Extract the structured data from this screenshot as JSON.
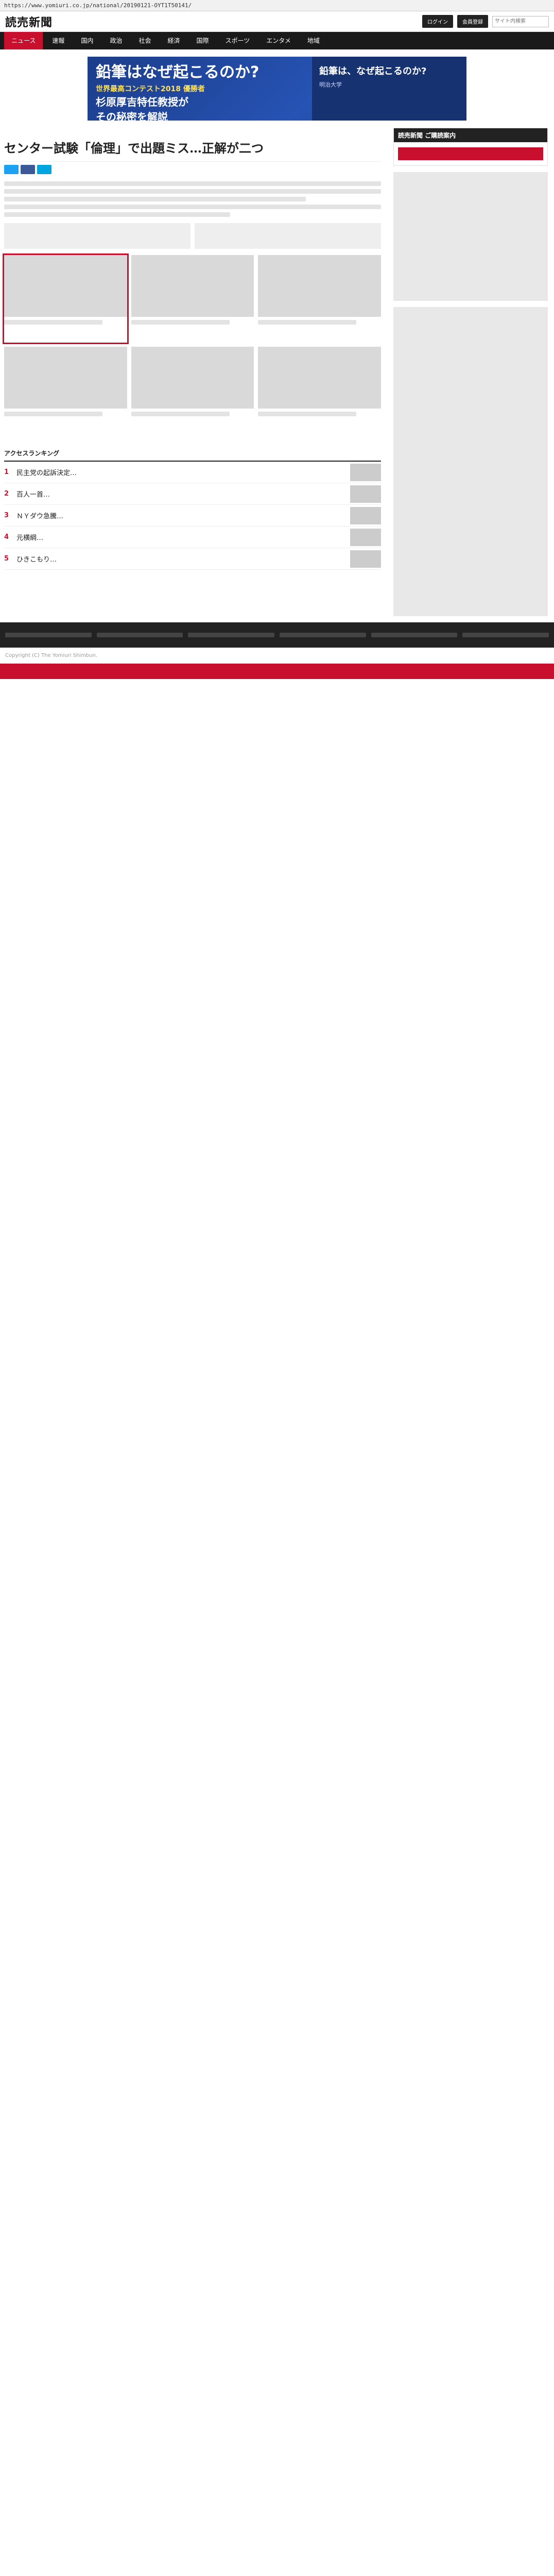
{
  "browser": {
    "url": "https://www.yomiuri.co.jp/national/20190121-OYT1T50141/"
  },
  "masthead": {
    "logo": "読売新聞",
    "login": "ログイン",
    "register": "会員登録",
    "search_placeholder": "サイト内検索"
  },
  "nav": {
    "items": [
      "ニュース",
      "速報",
      "国内",
      "政治",
      "社会",
      "経済",
      "国際",
      "スポーツ",
      "エンタメ",
      "地域"
    ]
  },
  "banner": {
    "headline": "鉛筆はなぜ起こるのか?",
    "event": "世界最高コンテスト2018 優勝者",
    "person": "杉原厚吉特任教授が",
    "tagline": "その秘密を解説",
    "right_title": "鉛筆は、なぜ起こるのか?",
    "right_sub": "明治大学"
  },
  "article": {
    "headline": "センター試験「倫理」で出題ミス…正解が二つ"
  },
  "ranking": {
    "title": "アクセスランキング",
    "rows": [
      {
        "rank": "1",
        "title": "民主党の起訴決定…"
      },
      {
        "rank": "2",
        "title": "百人一首…"
      },
      {
        "rank": "3",
        "title": "ＮＹダウ急騰…"
      },
      {
        "rank": "4",
        "title": "元横綱…"
      },
      {
        "rank": "5",
        "title": "ひきこもり…"
      }
    ]
  },
  "sidebar": {
    "subscribe_title": "読売新聞 ご購読案内"
  },
  "footer": {
    "copyright": "Copyright (C) The Yomiuri Shimbun."
  }
}
